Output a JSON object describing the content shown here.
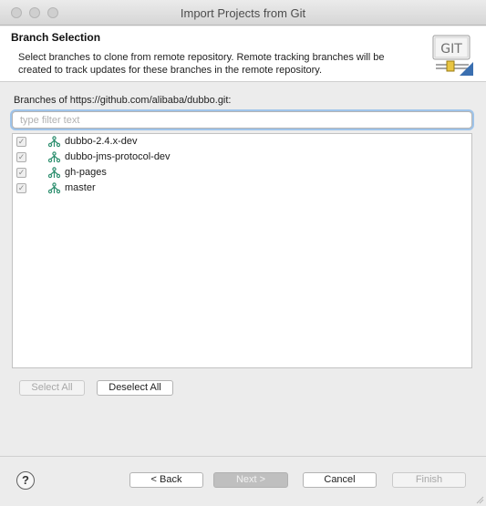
{
  "window": {
    "title": "Import Projects from Git"
  },
  "banner": {
    "title": "Branch Selection",
    "description": "Select branches to clone from remote repository. Remote tracking branches will be created to track updates for these branches in the remote repository.",
    "logo_text": "GIT",
    "logo_icon": "git-logo"
  },
  "branches_section": {
    "label": "Branches of https://github.com/alibaba/dubbo.git:",
    "filter_placeholder": "type filter text",
    "filter_value": "",
    "items": [
      {
        "label": "dubbo-2.4.x-dev",
        "checked": true
      },
      {
        "label": "dubbo-jms-protocol-dev",
        "checked": true
      },
      {
        "label": "gh-pages",
        "checked": true
      },
      {
        "label": "master",
        "checked": true
      }
    ]
  },
  "selection_buttons": {
    "select_all": "Select All",
    "deselect_all": "Deselect All"
  },
  "footer": {
    "help_icon": "question-mark-icon",
    "back": "< Back",
    "next": "Next >",
    "cancel": "Cancel",
    "finish": "Finish"
  },
  "colors": {
    "focus_ring": "#9fc4ea",
    "branch_icon": "#2d8f6f",
    "logo_accent": "#c9a227"
  }
}
